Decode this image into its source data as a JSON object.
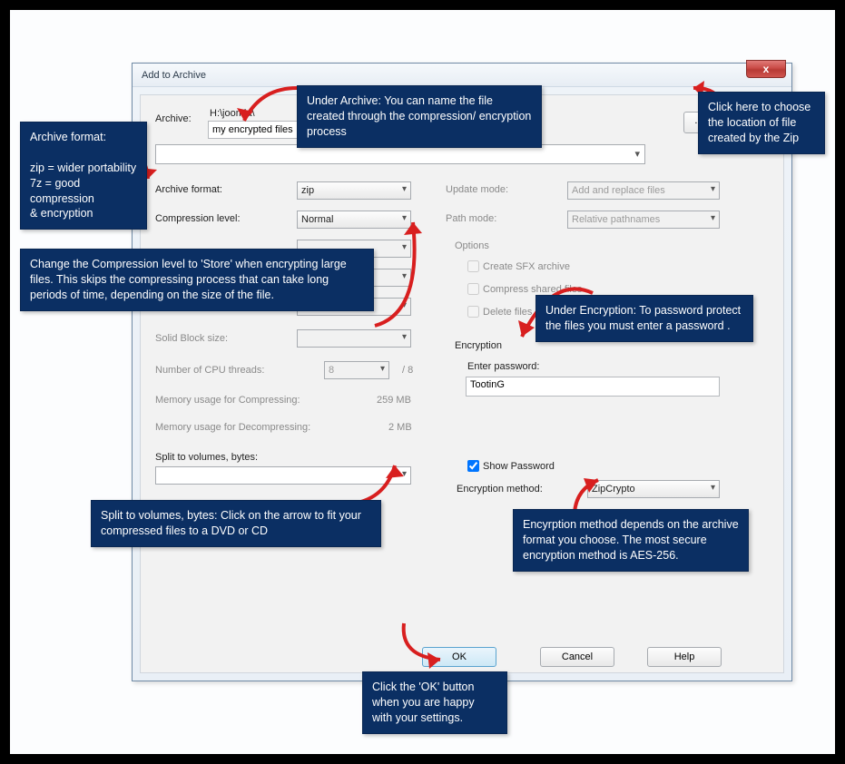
{
  "dialog": {
    "title": "Add to Archive",
    "close": "x",
    "archive_label": "Archive:",
    "archive_path": "H:\\joomla\\",
    "archive_name": "my encrypted files",
    "browse": "...",
    "format_label": "Archive format:",
    "format_value": "zip",
    "compression_label": "Compression level:",
    "compression_value": "Normal",
    "solid_label": "Solid Block size:",
    "cpu_label": "Number of CPU threads:",
    "cpu_value": "8",
    "cpu_max": "/ 8",
    "mem_comp_label": "Memory usage for Compressing:",
    "mem_comp_value": "259 MB",
    "mem_decomp_label": "Memory usage for Decompressing:",
    "mem_decomp_value": "2 MB",
    "split_label": "Split to volumes, bytes:",
    "update_label": "Update mode:",
    "update_value": "Add and replace files",
    "path_label": "Path mode:",
    "path_value": "Relative pathnames",
    "options_label": "Options",
    "opt_sfx": "Create SFX archive",
    "opt_shared": "Compress shared files",
    "opt_delete": "Delete files afte",
    "encryption_label": "Encryption",
    "enter_pw_label": "Enter password:",
    "password_value": "TootinG",
    "show_pw": "Show Password",
    "enc_method_label": "Encryption method:",
    "enc_method_value": "ZipCrypto",
    "ok": "OK",
    "cancel": "Cancel",
    "help": "Help"
  },
  "callouts": {
    "archive_name": "Under Archive: You can name the file created through the compression/ encryption process",
    "browse": "Click here to choose the location of file created by the Zip",
    "format": "Archive format:\n\nzip = wider portability\n7z = good compression\n       & encryption",
    "compression": "Change the Compression level to 'Store' when encrypting large files. This skips the compressing  process that can take long periods of time, depending on the size of the file.",
    "split": "Split to volumes, bytes: Click on the arrow to fit your compressed files to a DVD or CD",
    "encryption": "Under Encryption: To password protect the files you must enter a password .",
    "enc_method": "Encyrption method depends on the archive format you choose. The most secure encryption method is AES-256.",
    "ok": "Click the 'OK' button when you are happy with your settings."
  }
}
